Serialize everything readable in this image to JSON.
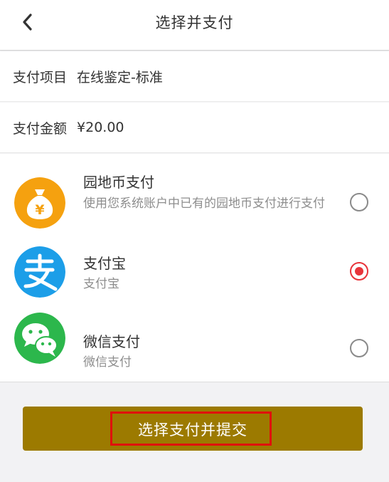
{
  "header": {
    "title": "选择并支付",
    "back_icon": "chevron-left-icon"
  },
  "order": {
    "item_label": "支付项目",
    "item_value": "在线鉴定-标准",
    "amount_label": "支付金额",
    "amount_value": "¥20.00"
  },
  "payment_methods": [
    {
      "title": "园地币支付",
      "description": "使用您系统账户中已有的园地币支付进行支付",
      "icon": "money-bag-icon",
      "selected": false
    },
    {
      "title": "支付宝",
      "description": "支付宝",
      "icon": "alipay-icon",
      "selected": true
    },
    {
      "title": "微信支付",
      "description": "微信支付",
      "icon": "wechat-icon",
      "selected": false
    }
  ],
  "submit": {
    "label": "选择支付并提交"
  },
  "colors": {
    "accent_red": "#e8343a",
    "button_gold": "#9c7a00",
    "coin_orange": "#f5a10f",
    "alipay_blue": "#1c9ee8",
    "wechat_green": "#2cb74c"
  }
}
